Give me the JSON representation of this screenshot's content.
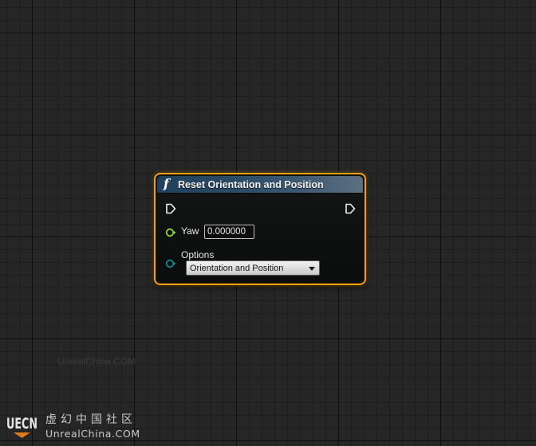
{
  "node": {
    "title": "Reset Orientation and Position",
    "function_icon": "function-f-icon",
    "header_color": "#2a4a66",
    "border_color": "#f5a10f",
    "exec_pins": {
      "input_icon": "exec-pin-icon",
      "output_icon": "exec-pin-icon"
    },
    "yaw": {
      "label": "Yaw",
      "value": "0.000000",
      "pin_color": "#8bd54a"
    },
    "options": {
      "label": "Options",
      "selected": "Orientation and Position",
      "pin_color": "#0e8a8a"
    }
  },
  "watermark": {
    "faint_text": "UnrealChina.COM",
    "logo_icon": "uecn-logo-icon",
    "logo_text": "UECN",
    "cn_text": "虚幻中国社区",
    "en_text": "UnrealChina.COM"
  }
}
